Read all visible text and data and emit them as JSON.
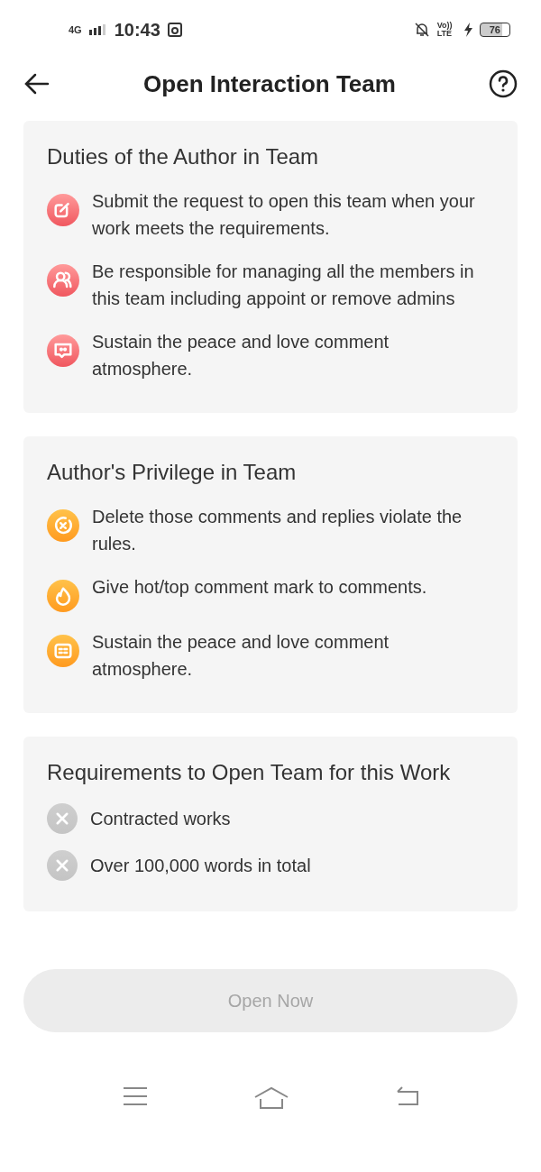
{
  "status_bar": {
    "network": "4G",
    "time": "10:43",
    "volte": "Vo)) LTE",
    "battery": "76"
  },
  "header": {
    "title": "Open Interaction Team"
  },
  "sections": [
    {
      "title": "Duties of the Author in Team",
      "kind": "duties",
      "items": [
        {
          "text": "Submit the request to open this team when your work meets the requirements."
        },
        {
          "text": "Be responsible for managing all the members in this team including appoint or remove admins"
        },
        {
          "text": "Sustain the peace and love comment atmosphere."
        }
      ]
    },
    {
      "title": "Author's Privilege in Team",
      "kind": "privileges",
      "items": [
        {
          "text": "Delete those comments and replies violate the rules."
        },
        {
          "text": "Give hot/top comment mark to comments."
        },
        {
          "text": "Sustain the peace and love comment atmosphere."
        }
      ]
    },
    {
      "title": "Requirements to Open Team for this Work",
      "kind": "requirements",
      "items": [
        {
          "text": "Contracted works",
          "met": false
        },
        {
          "text": "Over 100,000 words in total",
          "met": false
        }
      ]
    }
  ],
  "open_button": {
    "label": "Open Now",
    "disabled": true
  }
}
